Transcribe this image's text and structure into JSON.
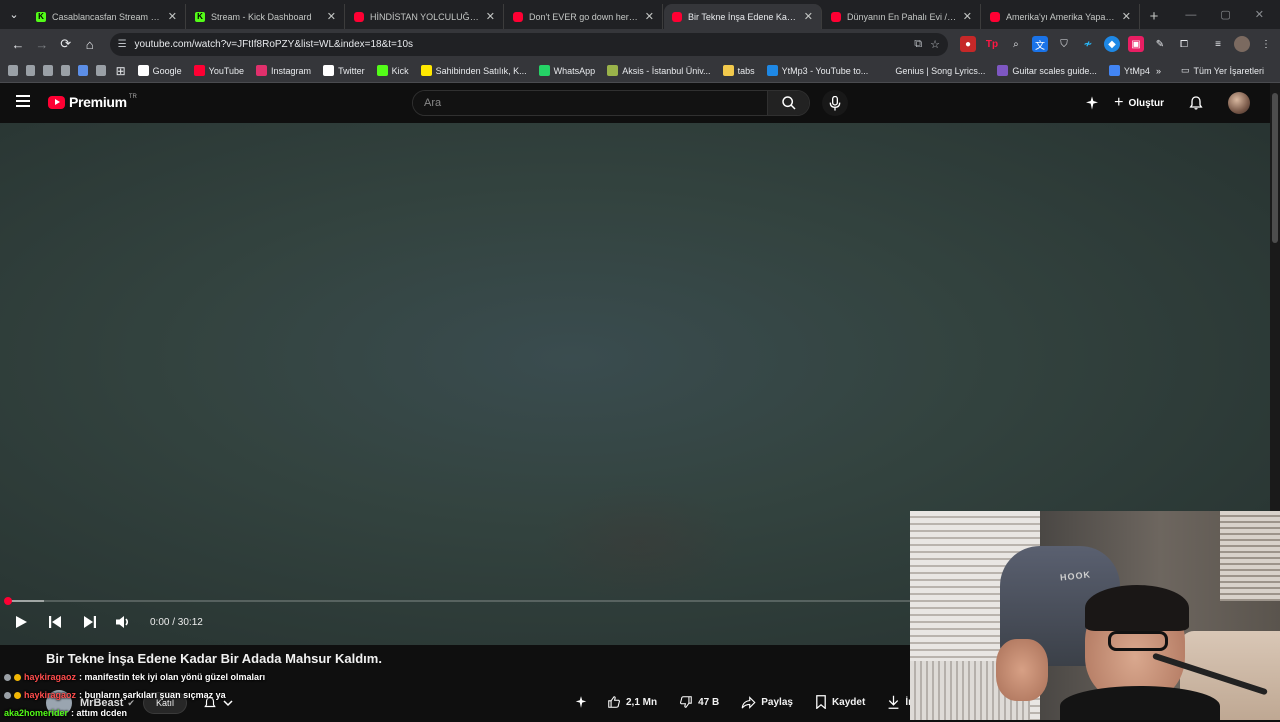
{
  "browser": {
    "tabs": [
      {
        "title": "Casablancasfan Stream - Watch",
        "favicon": "kick-icon",
        "active": false
      },
      {
        "title": "Stream - Kick Dashboard",
        "favicon": "kick-icon",
        "active": false
      },
      {
        "title": "HİNDİSTAN YOLCULUĞU VE HİN",
        "favicon": "youtube-icon",
        "active": false
      },
      {
        "title": "Don't EVER go down here... (Pa",
        "favicon": "youtube-icon",
        "active": false
      },
      {
        "title": "Bir Tekne İnşa Edene Kadar Bir A",
        "favicon": "youtube-icon",
        "active": true
      },
      {
        "title": "Dünyanın En Pahalı Evi / New Y",
        "favicon": "youtube-icon",
        "active": false
      },
      {
        "title": "Amerika'yı Amerika Yapan Top",
        "favicon": "youtube-icon",
        "active": false
      }
    ],
    "url": "youtube.com/watch?v=JFtIf8RoPZY&list=WL&index=18&t=10s",
    "bookmarks": [
      {
        "label": "Google",
        "icon": "google-icon",
        "color": "#ffffff"
      },
      {
        "label": "YouTube",
        "icon": "youtube-icon",
        "color": "#ff0033"
      },
      {
        "label": "Instagram",
        "icon": "instagram-icon",
        "color": "#e1306c"
      },
      {
        "label": "Twitter",
        "icon": "x-icon",
        "color": "#ffffff"
      },
      {
        "label": "Kick",
        "icon": "kick-icon",
        "color": "#53fc18"
      },
      {
        "label": "Sahibinden Satılık, K...",
        "icon": "sahibinden-icon",
        "color": "#ffe800"
      },
      {
        "label": "WhatsApp",
        "icon": "whatsapp-icon",
        "color": "#25d366"
      },
      {
        "label": "Aksis - İstanbul Üniv...",
        "icon": "aksis-icon",
        "color": "#9ab34a"
      },
      {
        "label": "tabs",
        "icon": "tabs-icon",
        "color": "#f2c94c"
      },
      {
        "label": "YtMp3 - YouTube to...",
        "icon": "ytmp3-icon",
        "color": "#1e88e5"
      },
      {
        "label": "Genius | Song Lyrics...",
        "icon": "genius-icon",
        "color": "#35363a"
      },
      {
        "label": "Guitar scales guide...",
        "icon": "guitar-icon",
        "color": "#7e57c2"
      },
      {
        "label": "YtMp4",
        "icon": "cloud-icon",
        "color": "#4285f4"
      }
    ],
    "all_bookmarks_label": "Tüm Yer İşaretleri"
  },
  "youtube": {
    "logo_word": "Premium",
    "logo_region": "TR",
    "search_placeholder": "Ara",
    "create_label": "Oluştur",
    "video": {
      "time_current": "0:00",
      "time_total": "30:12",
      "time_display": "0:00 / 30:12",
      "progress_fraction": 0.0,
      "buffer_fraction": 0.03,
      "title": "Bir Tekne İnşa Edene Kadar Bir Adada Mahsur Kaldım."
    },
    "channel": {
      "name": "MrBeast",
      "join_label": "Katıl"
    },
    "actions": {
      "likes": "2,1 Mn",
      "dislikes": "47 B",
      "share": "Paylaş",
      "save": "Kaydet",
      "download": "İndir"
    }
  },
  "stream_overlay": {
    "chat": [
      {
        "user": "haykiragaoz",
        "message": ": manifestin tek iyi olan yönü güzel olmaları",
        "user_color": "#ff4d4d"
      },
      {
        "user": "haykiragaoz",
        "message": ": bunların şarkıları şuan sıçmaz ya",
        "user_color": "#ff4d4d"
      },
      {
        "user": "aka2homerider",
        "message": ": attım dcden",
        "user_color": "#53fc18"
      }
    ],
    "webcam_chair_text": "HOOK"
  }
}
